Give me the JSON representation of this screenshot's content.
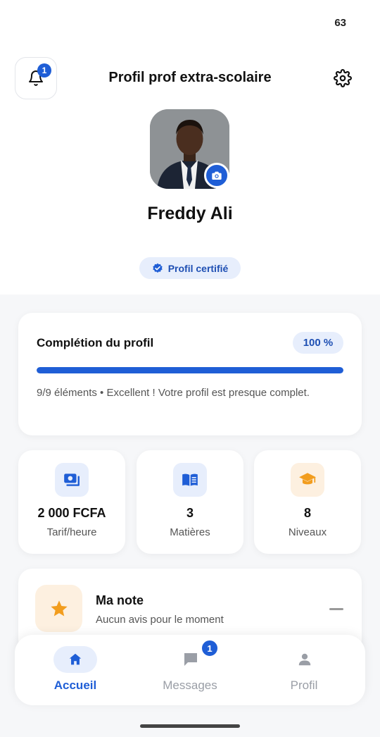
{
  "status": {
    "number": "63"
  },
  "header": {
    "title": "Profil prof extra-scolaire",
    "notification_count": "1"
  },
  "profile": {
    "name": "Freddy Ali",
    "certified_label": "Profil certifié"
  },
  "completion": {
    "title": "Complétion du profil",
    "percent_label": "100 %",
    "progress": 1.0,
    "detail": "9/9 éléments  •  Excellent ! Votre profil est presque complet."
  },
  "stats": [
    {
      "value": "2 000 FCFA",
      "label": "Tarif/heure",
      "icon": "money-icon"
    },
    {
      "value": "3",
      "label": "Matières",
      "icon": "book-icon"
    },
    {
      "value": "8",
      "label": "Niveaux",
      "icon": "graduation-cap-icon"
    }
  ],
  "rating": {
    "title": "Ma note",
    "subtitle": "Aucun avis pour le moment",
    "icon": "star-icon"
  },
  "nav": {
    "items": [
      {
        "label": "Accueil",
        "icon": "home-icon",
        "active": true
      },
      {
        "label": "Messages",
        "icon": "chat-icon",
        "badge": "1"
      },
      {
        "label": "Profil",
        "icon": "person-icon"
      }
    ]
  },
  "colors": {
    "accent": "#1f5ed6",
    "accent_light": "#e7eefc",
    "orange": "#f29d1e",
    "orange_light": "#fdf0e0"
  }
}
